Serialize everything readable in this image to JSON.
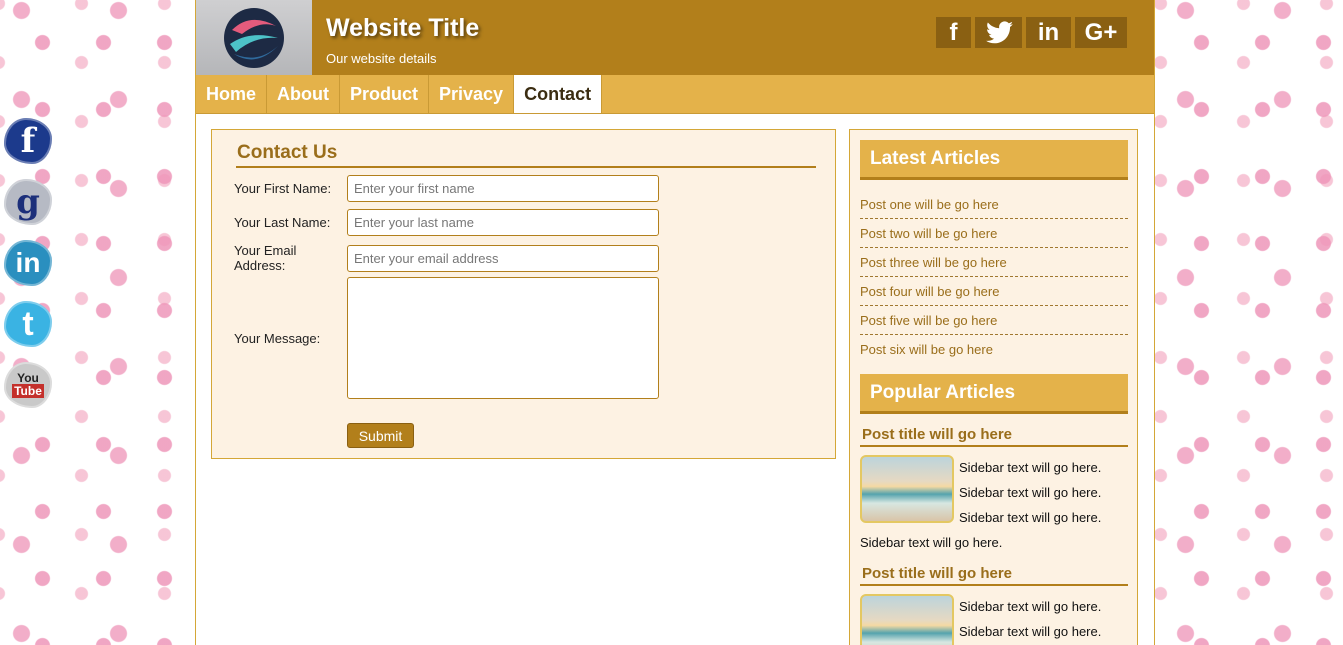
{
  "site": {
    "title": "Website Title",
    "subtitle": "Our website details"
  },
  "header_social": [
    {
      "icon": "facebook-icon",
      "glyph": "f"
    },
    {
      "icon": "twitter-icon",
      "glyph": "🐦"
    },
    {
      "icon": "linkedin-icon",
      "glyph": "in"
    },
    {
      "icon": "google-plus-icon",
      "glyph": "G+"
    }
  ],
  "floating_social": [
    {
      "icon": "facebook-icon",
      "glyph": "f",
      "color": "#1c3a8c"
    },
    {
      "icon": "google-icon",
      "glyph": "g",
      "color": "#9aa0ad"
    },
    {
      "icon": "linkedin-icon",
      "glyph": "in",
      "color": "#2a8fbf"
    },
    {
      "icon": "twitter-icon",
      "glyph": "t",
      "color": "#3ab3e3"
    },
    {
      "icon": "youtube-icon",
      "glyph": "You Tube",
      "color": "#b9b9b9"
    }
  ],
  "nav": {
    "items": [
      "Home",
      "About",
      "Product",
      "Privacy",
      "Contact"
    ],
    "active": "Contact"
  },
  "contact": {
    "heading": "Contact Us",
    "first_name_label": "Your First Name:",
    "first_name_placeholder": "Enter your first name",
    "last_name_label": "Your Last Name:",
    "last_name_placeholder": "Enter your last name",
    "email_label": "Your Email Address:",
    "email_placeholder": "Enter your email address",
    "message_label": "Your Message:",
    "submit_label": "Submit"
  },
  "sidebar": {
    "latest_heading": "Latest Articles",
    "latest": [
      "Post one will be go here",
      "Post two will be go here",
      "Post three will be go here",
      "Post four will be go here",
      "Post five will be go here",
      "Post six will be go here"
    ],
    "popular_heading": "Popular Articles",
    "popular": [
      {
        "title": "Post title will go here",
        "text": "Sidebar text will go here. Sidebar text will go here. Sidebar text will go here. Sidebar text will go here."
      },
      {
        "title": "Post title will go here",
        "text": "Sidebar text will go here. Sidebar text will go here."
      }
    ]
  },
  "colors": {
    "header": "#b27f1b",
    "nav": "#e4b24a",
    "panel": "#fdf2e3",
    "link": "#9a6e1b"
  }
}
